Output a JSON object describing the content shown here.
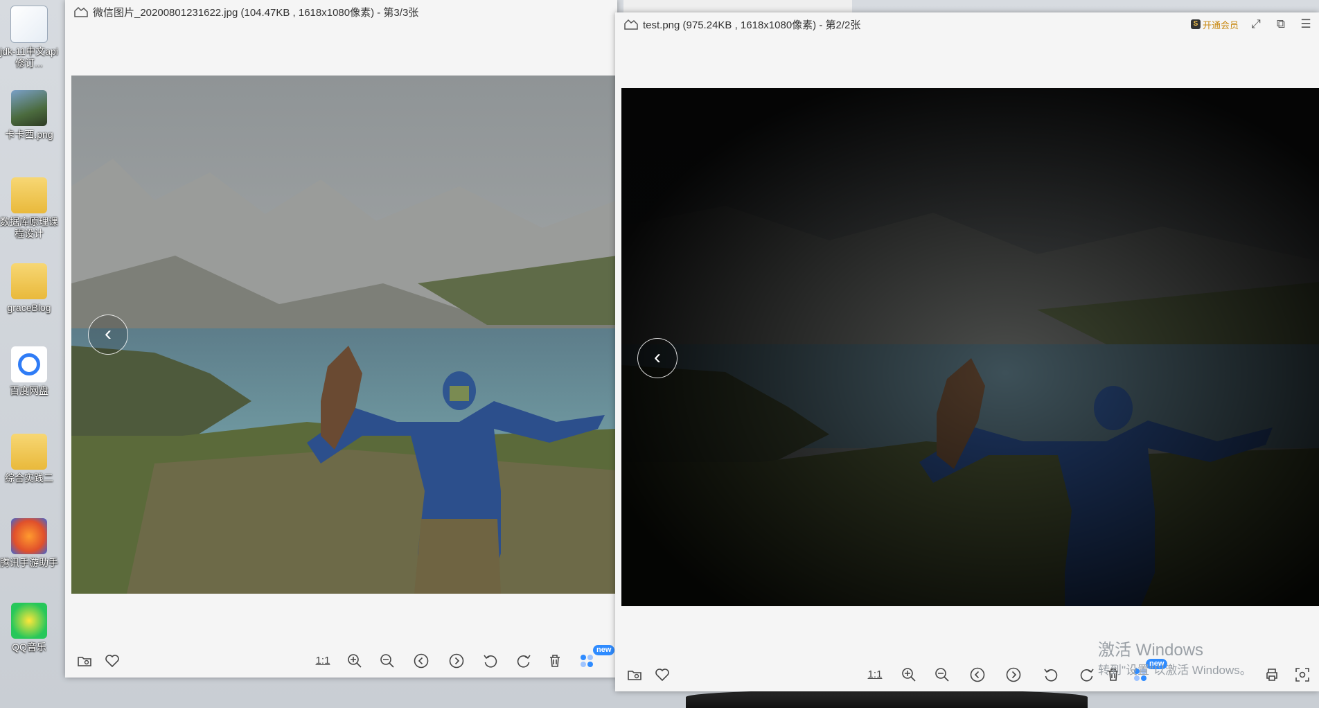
{
  "desktop": {
    "icons": [
      {
        "label": "jdk-11中文api修订...",
        "icon": "document-icon"
      },
      {
        "label": "卡卡西.png",
        "icon": "image-file-icon"
      },
      {
        "label": "数据库原理课程设计",
        "icon": "folder-icon"
      },
      {
        "label": "graceBlog",
        "icon": "folder-icon"
      },
      {
        "label": "百度网盘",
        "icon": "baidu-netdisk-icon"
      },
      {
        "label": "综合实践二",
        "icon": "folder-icon"
      },
      {
        "label": "腾讯手游助手",
        "icon": "game-assistant-icon"
      },
      {
        "label": "QQ音乐",
        "icon": "qq-music-icon"
      }
    ]
  },
  "viewer1": {
    "title": "微信图片_20200801231622.jpg (104.47KB , 1618x1080像素) - 第3/3张",
    "toolbar": {
      "ratio_label": "1:1",
      "new_badge": "new"
    }
  },
  "viewer2": {
    "title": "test.png (975.24KB , 1618x1080像素) - 第2/2张",
    "vip_label": "开通会员",
    "toolbar": {
      "ratio_label": "1:1",
      "new_badge": "new"
    }
  },
  "watermark": {
    "line1": "激活 Windows",
    "line2": "转到\"设置\"以激活 Windows。"
  },
  "colors": {
    "toolbar_icon": "#444444",
    "new_badge": "#2e8bff",
    "vip_text": "#c98a14"
  }
}
